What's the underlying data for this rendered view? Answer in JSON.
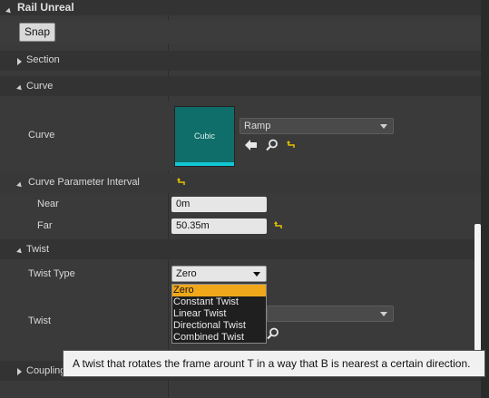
{
  "panel": {
    "category_title": "Rail Unreal",
    "snap_button": "Snap"
  },
  "sections": {
    "section_label": "Section",
    "curve_label": "Curve",
    "curve_param_interval_label": "Curve Parameter Interval",
    "twist_label": "Twist",
    "coupling_label": "Coupling"
  },
  "curve": {
    "property_label": "Curve",
    "thumbnail_text": "Cubic",
    "asset_combo_value": "Ramp"
  },
  "interval": {
    "near_label": "Near",
    "near_value": "0m",
    "far_label": "Far",
    "far_value": "50.35m"
  },
  "twist": {
    "twist_type_label": "Twist Type",
    "twist_type_value": "Zero",
    "twist_label": "Twist",
    "options": [
      "Zero",
      "Constant Twist",
      "Linear Twist",
      "Directional Twist",
      "Combined Twist"
    ],
    "selected_index": 0
  },
  "tooltip": {
    "text": "A twist that rotates the frame arount T in a way that B is nearest a certain direction."
  },
  "colors": {
    "accent": "#f0a81a",
    "thumbnail": "#0f6e6a",
    "thumbnail_bar": "#12c7d4",
    "reset_icon": "#e6c200"
  }
}
